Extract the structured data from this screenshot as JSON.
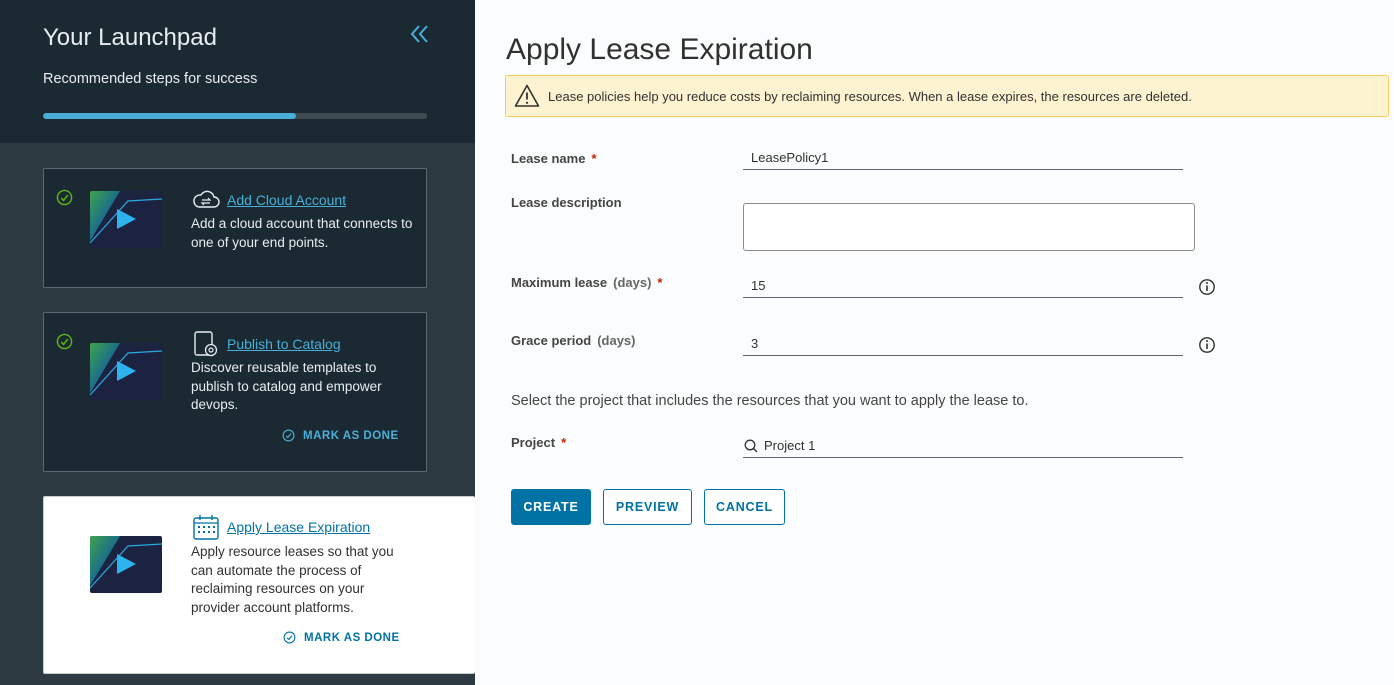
{
  "sidebar": {
    "title": "Your Launchpad",
    "subtitle": "Recommended steps for success",
    "progress_percent": 66,
    "colors": {
      "accent": "#49afd9",
      "success": "#5eb715"
    },
    "cards": [
      {
        "link": "Add Cloud Account",
        "description": "Add a cloud account that connects to one of your end points.",
        "icon": "cloud-sync-icon",
        "completed": true
      },
      {
        "link": "Publish to Catalog",
        "description": "Discover reusable templates to publish to catalog and empower devops.",
        "mark_done": "MARK AS DONE",
        "icon": "document-gear-icon",
        "completed": true
      },
      {
        "link": "Apply Lease Expiration",
        "description": "Apply resource leases so that you can automate the process of reclaiming resources on your provider account platforms.",
        "mark_done": "MARK AS DONE",
        "icon": "calendar-icon",
        "completed": false,
        "active": true
      }
    ]
  },
  "main": {
    "title": "Apply Lease Expiration",
    "alert": "Lease policies help you reduce costs by reclaiming resources. When a lease expires, the resources are deleted.",
    "form": {
      "lease_name_label": "Lease name",
      "lease_name_value": "LeasePolicy1",
      "lease_description_label": "Lease description",
      "lease_description_value": "",
      "max_lease_label": "Maximum lease",
      "max_lease_hint": "(days)",
      "max_lease_value": "15",
      "grace_period_label": "Grace period",
      "grace_period_hint": "(days)",
      "grace_period_value": "3",
      "project_instruction": "Select the project that includes the resources that you want to apply the lease to.",
      "project_label": "Project",
      "project_value": "Project 1",
      "required_marker": "*"
    },
    "buttons": {
      "create": "CREATE",
      "preview": "PREVIEW",
      "cancel": "CANCEL"
    },
    "colors": {
      "primary": "#0072a3",
      "warning_bg": "#fef3d0",
      "required": "#c92100"
    }
  }
}
